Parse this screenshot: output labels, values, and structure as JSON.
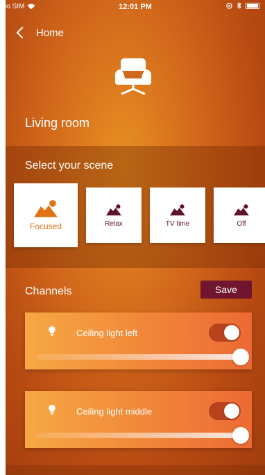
{
  "status_bar": {
    "carrier": "No SIM",
    "time": "12:01 PM"
  },
  "nav": {
    "back_label": "Home"
  },
  "room": {
    "title": "Living room",
    "icon": "armchair-icon"
  },
  "scenes": {
    "title": "Select your scene",
    "items": [
      {
        "label": "Focused",
        "selected": true
      },
      {
        "label": "Relax",
        "selected": false
      },
      {
        "label": "TV time",
        "selected": false
      },
      {
        "label": "Off",
        "selected": false
      }
    ]
  },
  "channels": {
    "title": "Channels",
    "save_label": "Save",
    "items": [
      {
        "name": "Ceiling light left",
        "on": true,
        "brightness": 1.0
      },
      {
        "name": "Ceiling light middle",
        "on": true,
        "brightness": 1.0
      }
    ]
  },
  "colors": {
    "accent": "#6f1530",
    "scene_selected_text": "#e07412",
    "scene_text": "#5e1428",
    "background": "#d2681b"
  }
}
